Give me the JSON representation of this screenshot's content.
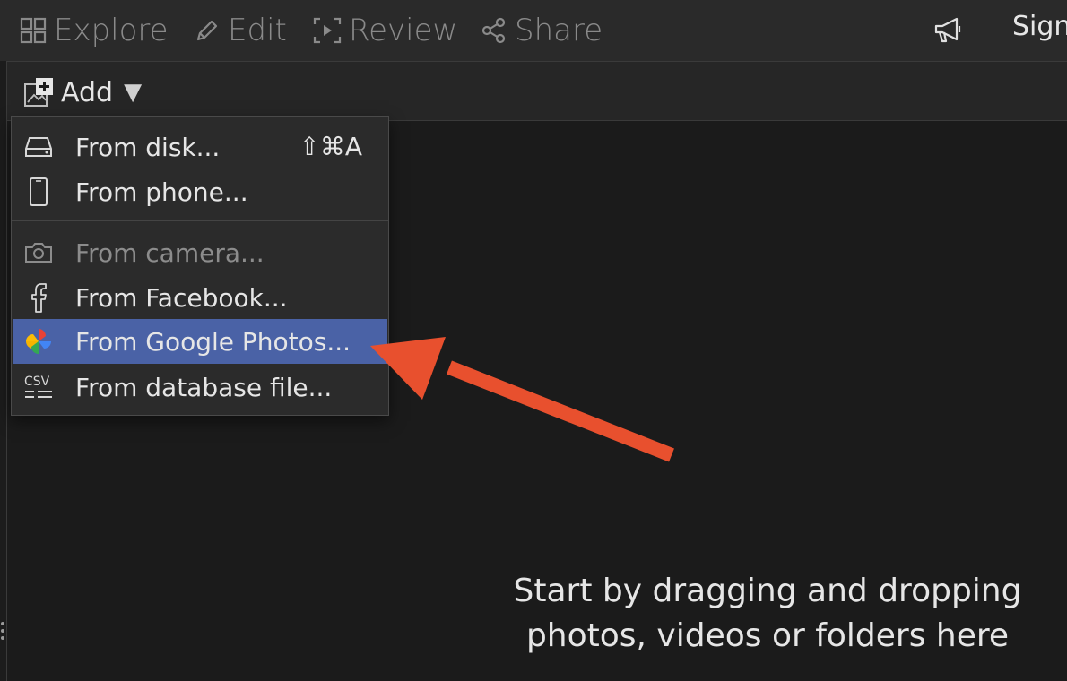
{
  "nav": {
    "explore": "Explore",
    "edit": "Edit",
    "review": "Review",
    "share": "Share",
    "sign_in": "Sign",
    "icons": [
      "grid-icon",
      "pencil-icon",
      "review-play-icon",
      "share-nodes-icon",
      "megaphone-icon"
    ]
  },
  "toolbar": {
    "add_label": "Add",
    "add_caret": "▼"
  },
  "menu": {
    "items": [
      {
        "label": "From disk...",
        "shortcut": "⇧⌘A",
        "icon": "disk-icon",
        "enabled": true
      },
      {
        "label": "From phone...",
        "icon": "phone-icon",
        "enabled": true
      },
      {
        "label": "From camera...",
        "icon": "camera-icon",
        "enabled": false
      },
      {
        "label": "From Facebook...",
        "icon": "facebook-icon",
        "enabled": true
      },
      {
        "label": "From Google Photos...",
        "icon": "google-photos-icon",
        "enabled": true,
        "selected": true
      },
      {
        "label": "From database file...",
        "icon": "csv-icon",
        "enabled": true
      }
    ],
    "csv_icon_text": "CSV"
  },
  "drop_hint": {
    "line1": "Start by dragging and dropping",
    "line2": "photos, videos or folders here"
  },
  "colors": {
    "selection": "#4a62a6",
    "arrow": "#e8502e",
    "background": "#1b1b1b"
  }
}
